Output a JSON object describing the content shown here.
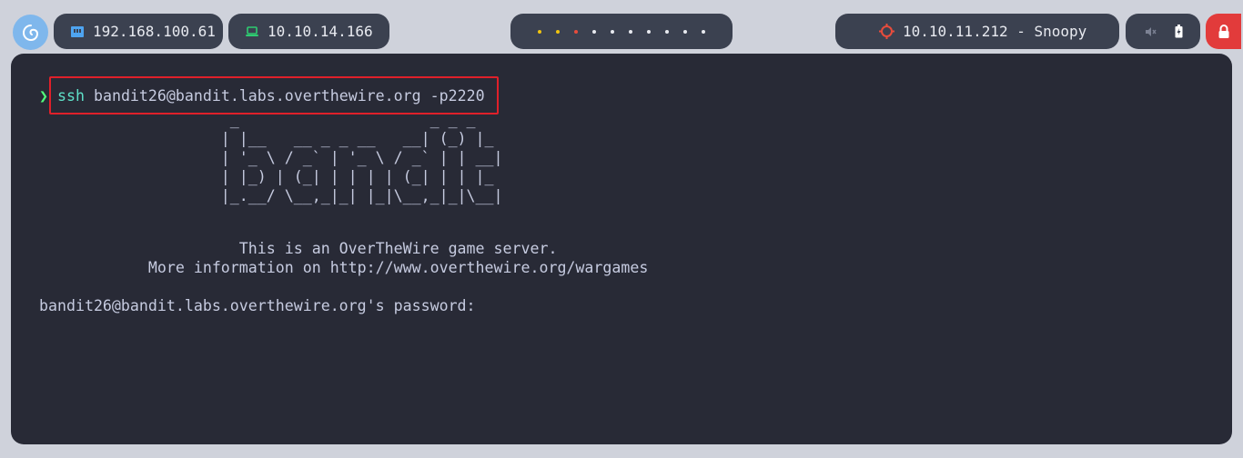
{
  "topbar": {
    "network_ip": "192.168.100.61",
    "vpn_ip": "10.10.14.166",
    "workspace_count": 10,
    "workspace_colors": [
      "#f1c40f",
      "#f1c40f",
      "#e74c3c",
      "#e8eaf0",
      "#e8eaf0",
      "#e8eaf0",
      "#e8eaf0",
      "#e8eaf0",
      "#e8eaf0",
      "#e8eaf0"
    ],
    "target_label": "10.10.11.212 - Snoopy",
    "icons": {
      "logo": "debian-swirl-icon",
      "network": "ethernet-icon",
      "vpn": "laptop-icon",
      "target": "crosshair-icon",
      "mute": "speaker-muted-icon",
      "battery": "battery-icon",
      "lock": "lock-icon"
    },
    "accent_colors": {
      "logo_bg": "#7fb7ec",
      "network_icon": "#4ea4f0",
      "vpn_icon": "#2ecc71",
      "target_icon": "#e74c3c",
      "lock_bg": "#e23b3b"
    }
  },
  "terminal": {
    "prompt_symbol": "❯",
    "command_name": "ssh",
    "command_args": " bandit26@bandit.labs.overthewire.org -p2220",
    "ascii_art": "                     _                     _ _ _\n                    | |__   __ _ _ __   __| (_) |_\n                    | '_ \\ / _` | '_ \\ / _` | | __|\n                    | |_) | (_| | | | | (_| | | |_\n                    |_.__/ \\__,_|_| |_|\\__,_|_|\\__|",
    "banner_line1": "                      This is an OverTheWire game server.",
    "banner_line2": "            More information on http://www.overthewire.org/wargames",
    "password_prompt": "bandit26@bandit.labs.overthewire.org's password:"
  }
}
